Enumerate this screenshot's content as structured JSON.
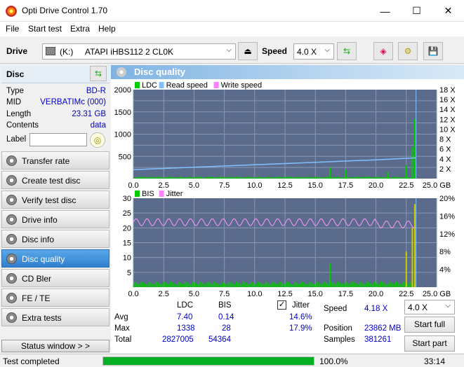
{
  "window": {
    "title": "Opti Drive Control 1.70",
    "minimize": "—",
    "maximize": "☐",
    "close": "✕"
  },
  "menu": [
    "File",
    "Start test",
    "Extra",
    "Help"
  ],
  "toolbar": {
    "drive_label": "Drive",
    "drive_letter": "(K:)",
    "drive_name": "ATAPI iHBS112  2 CL0K",
    "speed_label": "Speed",
    "speed_value": "4.0 X"
  },
  "disc": {
    "header": "Disc",
    "rows": [
      {
        "key": "Type",
        "value": "BD-R"
      },
      {
        "key": "MID",
        "value": "VERBATIMc (000)"
      },
      {
        "key": "Length",
        "value": "23.31 GB"
      },
      {
        "key": "Contents",
        "value": "data"
      },
      {
        "key": "Label",
        "value": ""
      }
    ]
  },
  "nav": [
    {
      "label": "Transfer rate",
      "active": false
    },
    {
      "label": "Create test disc",
      "active": false
    },
    {
      "label": "Verify test disc",
      "active": false
    },
    {
      "label": "Drive info",
      "active": false
    },
    {
      "label": "Disc info",
      "active": false
    },
    {
      "label": "Disc quality",
      "active": true
    },
    {
      "label": "CD Bler",
      "active": false
    },
    {
      "label": "FE / TE",
      "active": false
    },
    {
      "label": "Extra tests",
      "active": false
    }
  ],
  "status_window_label": "Status window > >",
  "panel_title": "Disc quality",
  "chart_data": [
    {
      "type": "bar",
      "title": "LDC chart",
      "legend": [
        "LDC",
        "Read speed",
        "Write speed"
      ],
      "colors": {
        "LDC": "#00cc00",
        "Read speed": "#80c0ff",
        "Write speed": "#ff80ff"
      },
      "x_ticks": [
        "0.0",
        "2.5",
        "5.0",
        "7.5",
        "10.0",
        "12.5",
        "15.0",
        "17.5",
        "20.0",
        "22.5",
        "25.0 GB"
      ],
      "y_left_ticks": [
        "2000",
        "1500",
        "1000",
        "500"
      ],
      "y_right_ticks": [
        "18 X",
        "16 X",
        "14 X",
        "12 X",
        "10 X",
        "8 X",
        "6 X",
        "4 X",
        "2 X"
      ],
      "xlim": [
        0,
        25
      ],
      "ylim": [
        0,
        2000
      ],
      "y2lim": [
        0,
        18
      ],
      "read_speed": {
        "x": [
          0,
          5,
          10,
          15,
          20,
          23.3
        ],
        "y": [
          1.8,
          2.3,
          2.8,
          3.3,
          3.8,
          4.2
        ]
      },
      "ldc_peaks": {
        "x": [
          16.2,
          17.5,
          21.0,
          22.5,
          23.0,
          23.2
        ],
        "y": [
          250,
          200,
          150,
          300,
          700,
          1338
        ]
      }
    },
    {
      "type": "bar",
      "title": "BIS chart",
      "legend": [
        "BIS",
        "Jitter"
      ],
      "colors": {
        "BIS": "#00cc00",
        "Jitter": "#ff80ff"
      },
      "x_ticks": [
        "0.0",
        "2.5",
        "5.0",
        "7.5",
        "10.0",
        "12.5",
        "15.0",
        "17.5",
        "20.0",
        "22.5",
        "25.0 GB"
      ],
      "y_left_ticks": [
        "30",
        "25",
        "20",
        "15",
        "10",
        "5"
      ],
      "y_right_ticks": [
        "20%",
        "16%",
        "12%",
        "8%",
        "4%"
      ],
      "xlim": [
        0,
        25
      ],
      "ylim": [
        0,
        30
      ],
      "y2lim": [
        0,
        20
      ],
      "jitter_avg": 14.6,
      "bis_peaks": {
        "x": [
          16.2,
          22.5,
          23.0,
          23.2
        ],
        "y": [
          8,
          12,
          20,
          28
        ]
      }
    }
  ],
  "stats": {
    "headers": [
      "LDC",
      "BIS"
    ],
    "jitter_label": "Jitter",
    "jitter_checked": true,
    "rows": [
      {
        "label": "Avg",
        "ldc": "7.40",
        "bis": "0.14",
        "jitter": "14.6%"
      },
      {
        "label": "Max",
        "ldc": "1338",
        "bis": "28",
        "jitter": "17.9%"
      },
      {
        "label": "Total",
        "ldc": "2827005",
        "bis": "54364",
        "jitter": ""
      }
    ],
    "speed_label": "Speed",
    "speed_value": "4.18 X",
    "position_label": "Position",
    "position_value": "23862 MB",
    "samples_label": "Samples",
    "samples_value": "381261",
    "speed_select": "4.0 X",
    "start_full": "Start full",
    "start_part": "Start part"
  },
  "statusbar": {
    "text": "Test completed",
    "progress": 100.0,
    "progress_label": "100.0%",
    "time": "33:14"
  }
}
